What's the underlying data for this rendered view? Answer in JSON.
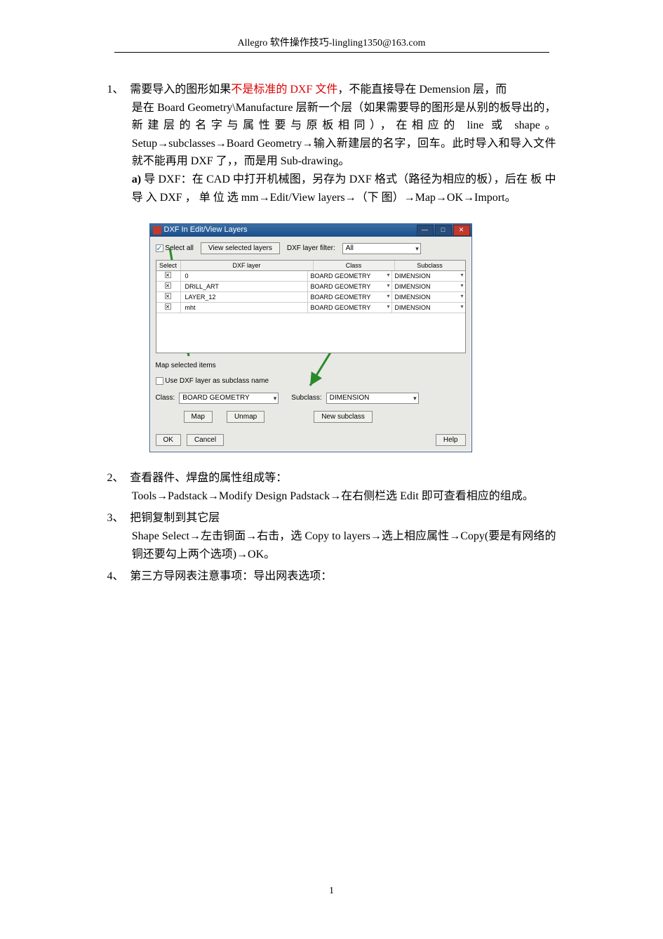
{
  "header": {
    "text": "Allegro 软件操作技巧-lingling1350@163.com"
  },
  "item1": {
    "num": "1、",
    "line1_a": "需要导入的图形如果",
    "line1_red": "不是标准的 DXF 文件",
    "line1_b": "，不能直接导在 Demension 层，而",
    "line2": "是在 Board Geometry\\Manufacture 层新一个层（如果需要导的图形是从别的板导出的，新建层的名字与属性要与原板相同），在相应的 line 或 shape。Setup→subclasses→Board Geometry→输入新建层的名字，回车。此时导入和导入文件就不能再用 DXF 了，，而是用 Sub-drawing。",
    "a_label": "a)",
    "a_text": "导 DXF：在 CAD 中打开机械图，另存为 DXF 格式（路径为相应的板），后在 板 中 导 入 DXF ， 单 位 选 mm→Edit/View layers→（下 图）→Map→OK→Import。"
  },
  "dialog": {
    "title": "DXF In Edit/View Layers",
    "select_all": "Select all",
    "view_btn": "View selected layers",
    "filter_label": "DXF layer filter:",
    "filter_value": "All",
    "head_select": "Select",
    "head_layer": "DXF layer",
    "head_class": "Class",
    "head_sub": "Subclass",
    "rows": [
      {
        "layer": "0",
        "class_": "BOARD GEOMETRY",
        "sub": "DIMENSION"
      },
      {
        "layer": "DRILL_ART",
        "class_": "BOARD GEOMETRY",
        "sub": "DIMENSION"
      },
      {
        "layer": "LAYER_12",
        "class_": "BOARD GEOMETRY",
        "sub": "DIMENSION"
      },
      {
        "layer": "mht",
        "class_": "BOARD GEOMETRY",
        "sub": "DIMENSION"
      }
    ],
    "map_heading": "Map selected items",
    "use_dxf_chk": "Use DXF layer as subclass name",
    "class_label": "Class:",
    "class_value": "BOARD GEOMETRY",
    "sub_label": "Subclass:",
    "sub_value": "DIMENSION",
    "map_btn": "Map",
    "unmap_btn": "Unmap",
    "newsub_btn": "New subclass",
    "ok_btn": "OK",
    "cancel_btn": "Cancel",
    "help_btn": "Help"
  },
  "item2": {
    "num": "2、",
    "line1": "查看器件、焊盘的属性组成等：",
    "line2": "Tools→Padstack→Modify Design Padstack→在右侧栏选 Edit 即可查看相应的组成。"
  },
  "item3": {
    "num": "3、",
    "line1": "把铜复制到其它层",
    "line2": "Shape Select→左击铜面→右击，选 Copy to layers→选上相应属性→Copy(要是有网络的铜还要勾上两个选项)→OK。"
  },
  "item4": {
    "num": "4、",
    "line1": "第三方导网表注意事项：导出网表选项："
  },
  "page_number": "1"
}
